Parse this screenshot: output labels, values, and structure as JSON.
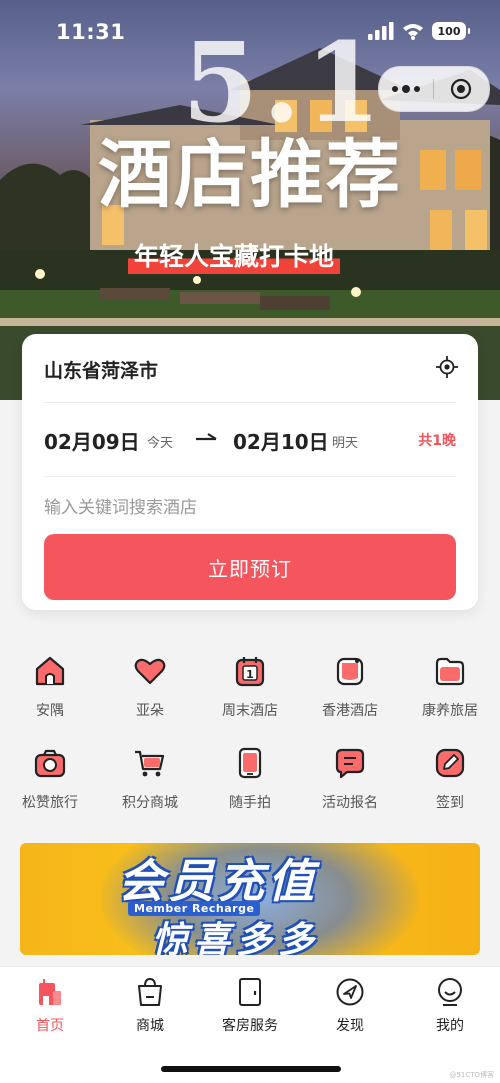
{
  "status_bar": {
    "time": "11:31",
    "battery": "100"
  },
  "hero": {
    "number": "5.1",
    "title": "酒店推荐",
    "subtitle": "年轻人宝藏打卡地"
  },
  "booking": {
    "city": "山东省菏泽市",
    "check_in": "02月09日",
    "check_in_tag": "今天",
    "check_out": "02月10日",
    "check_out_tag": "明天",
    "nights": "共1晚",
    "keyword_placeholder": "输入关键词搜索酒店",
    "book_label": "立即预订"
  },
  "services": [
    {
      "label": "安隅",
      "icon": "house-icon"
    },
    {
      "label": "亚朵",
      "icon": "heart-icon"
    },
    {
      "label": "周末酒店",
      "icon": "calendar-icon"
    },
    {
      "label": "香港酒店",
      "icon": "bag-icon"
    },
    {
      "label": "康养旅居",
      "icon": "folder-icon"
    },
    {
      "label": "松赞旅行",
      "icon": "camera-icon"
    },
    {
      "label": "积分商城",
      "icon": "cart-icon"
    },
    {
      "label": "随手拍",
      "icon": "phone-icon"
    },
    {
      "label": "活动报名",
      "icon": "chat-icon"
    },
    {
      "label": "签到",
      "icon": "edit-icon"
    }
  ],
  "banner": {
    "line1": "会员充值",
    "line2": "Member Recharge",
    "line3": "惊喜多多"
  },
  "tabs": [
    {
      "label": "首页",
      "icon": "home-icon",
      "active": true
    },
    {
      "label": "商城",
      "icon": "shopping-bag-icon",
      "active": false
    },
    {
      "label": "客房服务",
      "icon": "door-icon",
      "active": false
    },
    {
      "label": "发现",
      "icon": "compass-icon",
      "active": false
    },
    {
      "label": "我的",
      "icon": "user-icon",
      "active": false
    }
  ],
  "watermark": "@51CTO博客",
  "colors": {
    "accent": "#f5555d",
    "icon_fill": "#fb6b6b"
  }
}
